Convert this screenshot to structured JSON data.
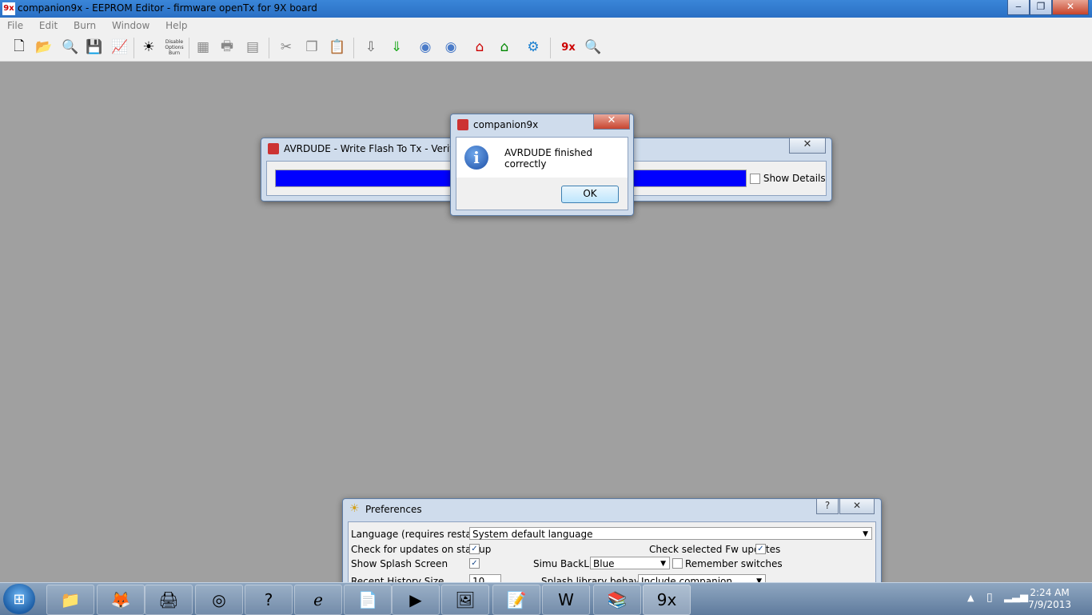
{
  "window": {
    "title": "companion9x - EEPROM Editor - firmware openTx for 9X board",
    "app_icon_text": "9x"
  },
  "menu": [
    "File",
    "Edit",
    "Burn",
    "Window",
    "Help"
  ],
  "toolbar": {
    "preview_items": [
      "Disable",
      "Options",
      "Burn"
    ]
  },
  "avrdude": {
    "title": "AVRDUDE - Write Flash To Tx - Verifyin",
    "show_details_label": "Show Details",
    "progress": 1.0,
    "bar_color": "#0000ff"
  },
  "msgbox": {
    "title": "companion9x",
    "message": "AVRDUDE finished correctly",
    "ok_label": "OK"
  },
  "preferences": {
    "title": "Preferences",
    "language_label": "Language (requires restart)",
    "language_value": "System default language",
    "check_updates_label": "Check for updates on startup",
    "check_fw_label": "Check selected Fw updates",
    "show_splash_label": "Show Splash Screen",
    "simu_backlight_label": "Simu BackLight",
    "simu_backlight_value": "Blue",
    "remember_switches_label": "Remember switches",
    "recent_history_label": "Recent History Size",
    "recent_history_value": "10",
    "splash_library_label": "Splash library behaviour",
    "splash_library_value": "Include companion splashes",
    "help_glyph": "?",
    "close_glyph": "✕"
  },
  "taskbar": {
    "time": "2:24 AM",
    "date": "7/9/2013"
  },
  "colors": {
    "desktop": "#a0a0a0",
    "accent": "#2a6fc4"
  }
}
